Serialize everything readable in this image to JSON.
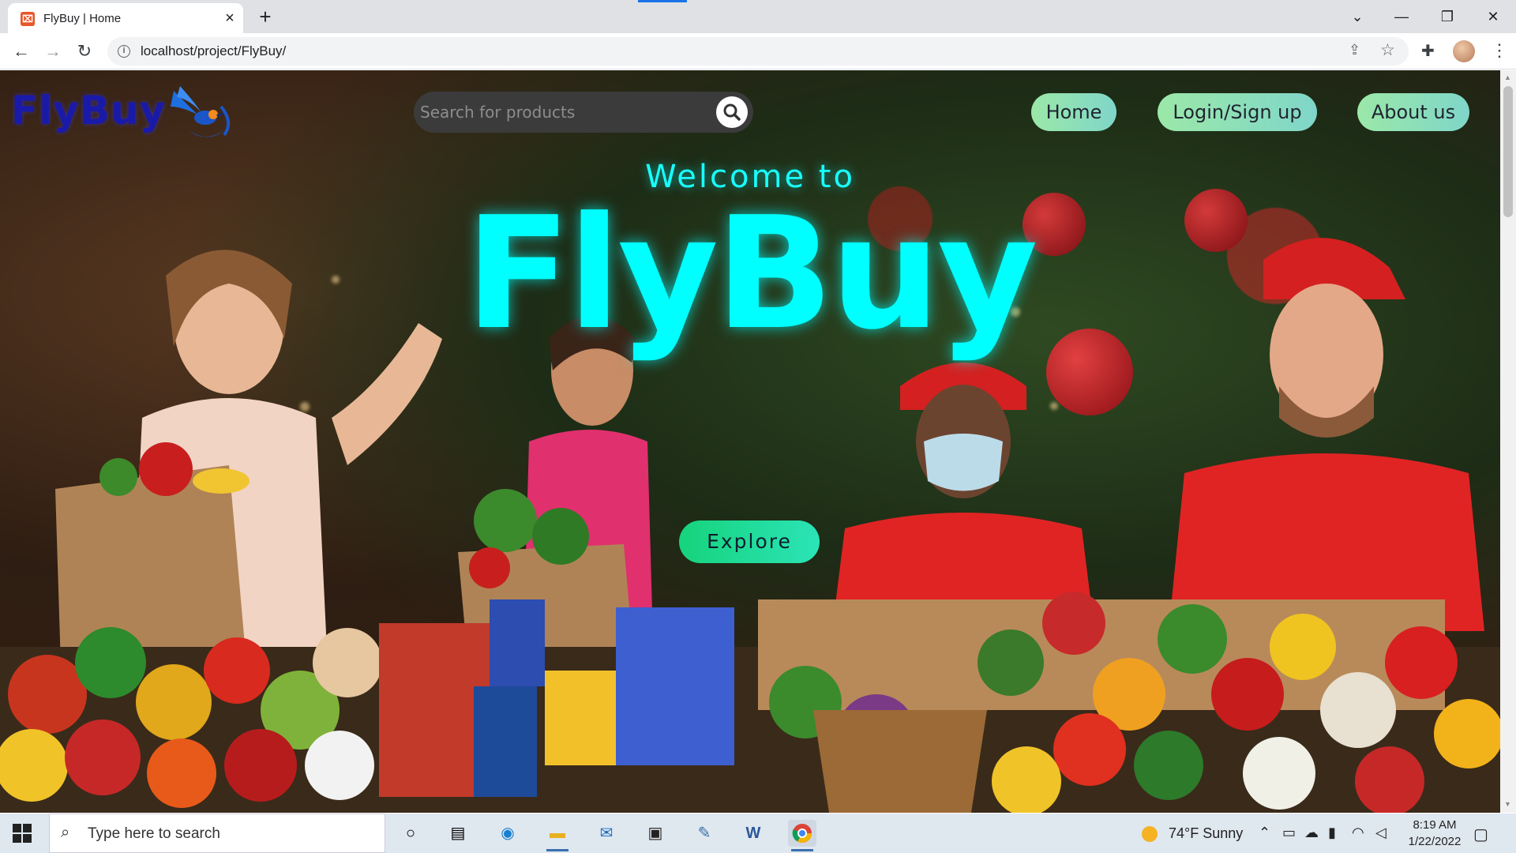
{
  "browser": {
    "tab_title": "FlyBuy | Home",
    "url": "localhost/project/FlyBuy/"
  },
  "page": {
    "logo": "FlyBuy",
    "search": {
      "placeholder": "Search for products"
    },
    "nav": [
      {
        "label": "Home"
      },
      {
        "label": "Login/Sign up"
      },
      {
        "label": "About us"
      }
    ],
    "hero": {
      "welcome": "Welcome to",
      "brand": "FlyBuy",
      "cta": "Explore"
    },
    "colors": {
      "accent": "#00ffff",
      "logo": "#1a1aa8",
      "nav_gradient_start": "#9be8a8",
      "nav_gradient_end": "#7fd6c9",
      "cta_gradient_start": "#16d37c",
      "cta_gradient_end": "#2be4b7"
    }
  },
  "taskbar": {
    "search_placeholder": "Type here to search",
    "weather": "74°F  Sunny",
    "time": "8:19 AM",
    "date": "1/22/2022",
    "apps": [
      "cortana-icon",
      "task-view-icon",
      "edge-icon",
      "file-explorer-icon",
      "mail-icon",
      "terminal-icon",
      "python-icon",
      "word-icon",
      "chrome-icon"
    ]
  }
}
